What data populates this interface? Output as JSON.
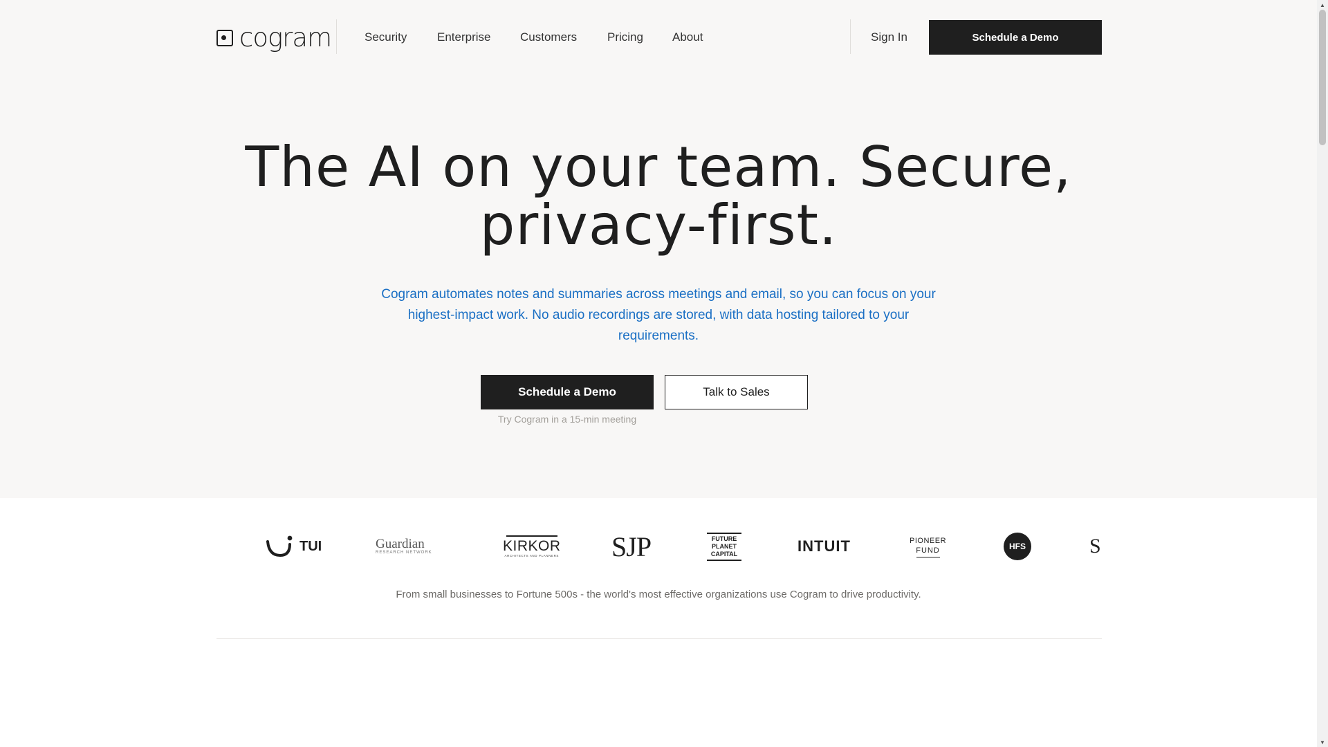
{
  "header": {
    "brand": "cogram",
    "brand_icon": "cogram-logo-icon",
    "nav": [
      {
        "label": "Security"
      },
      {
        "label": "Enterprise"
      },
      {
        "label": "Customers"
      },
      {
        "label": "Pricing"
      },
      {
        "label": "About"
      }
    ],
    "signin_label": "Sign In",
    "cta_label": "Schedule a Demo"
  },
  "hero": {
    "headline_line1": "The AI on your team. Secure,",
    "headline_line2": "privacy-first.",
    "subcopy": "Cogram automates notes and summaries across meetings and email, so you can focus on your highest-impact work. No audio recordings are stored, with data hosting tailored to your requirements.",
    "primary_cta": "Schedule a Demo",
    "secondary_cta": "Talk to Sales",
    "cta_note": "Try Cogram in a 15-min meeting"
  },
  "customers": {
    "logos": [
      {
        "name": "TUI",
        "text": "TUI"
      },
      {
        "name": "Guardian Research Network",
        "text": "Guardian",
        "subtext": "RESEARCH NETWORK"
      },
      {
        "name": "Kirkor",
        "text": "KIRKOR",
        "subtext": "ARCHITECTS AND PLANNERS"
      },
      {
        "name": "SJP",
        "text": "SJP"
      },
      {
        "name": "Future Planet Capital",
        "lines": [
          "FUTURE",
          "PLANET",
          "CAPITAL"
        ]
      },
      {
        "name": "Intuit",
        "text": "INTUIT"
      },
      {
        "name": "Pioneer Fund",
        "lines": [
          "PIONEER",
          "FUND"
        ]
      },
      {
        "name": "HFS",
        "text": "HFS"
      },
      {
        "name": "Partial logo",
        "text": "S"
      }
    ],
    "tagline": "From small businesses to Fortune 500s - the world's most effective organizations use Cogram to drive productivity."
  },
  "colors": {
    "hero_background": "#f8f7f6",
    "primary_button": "#1f1f1f",
    "body_link_blue": "#1a6fc4",
    "muted_text": "#a29f9a"
  }
}
